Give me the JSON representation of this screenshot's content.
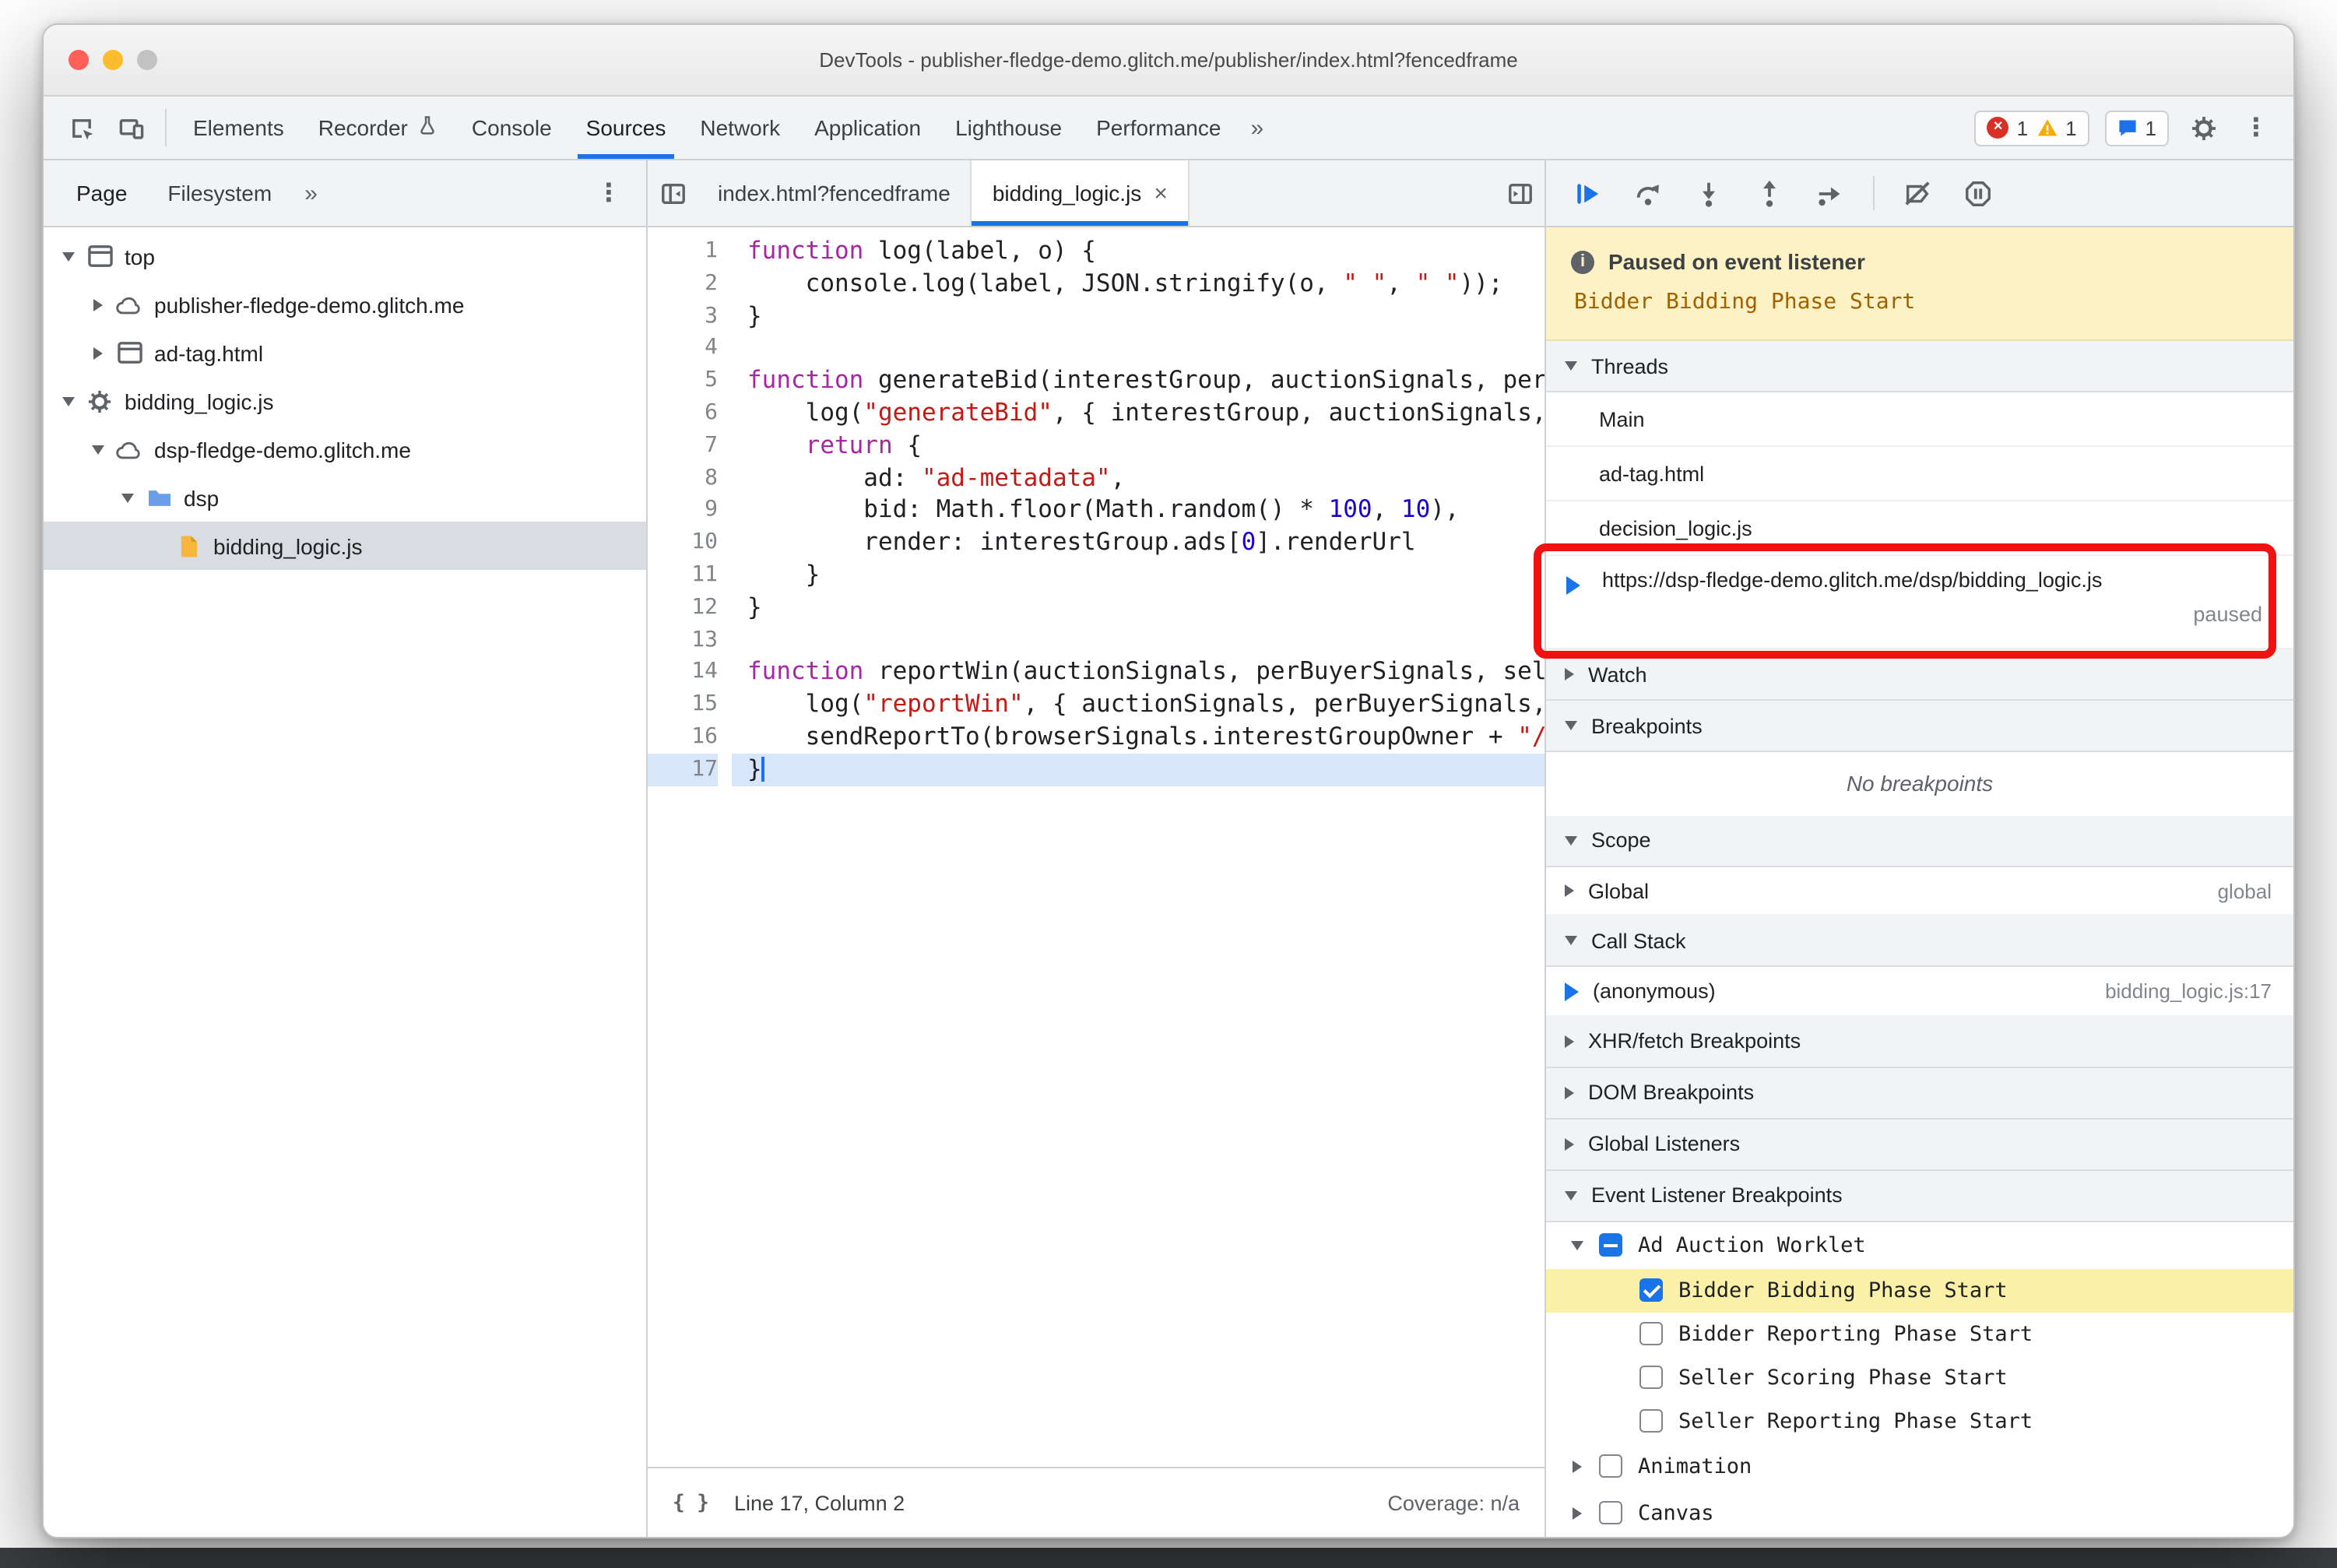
{
  "window": {
    "title": "DevTools - publisher-fledge-demo.glitch.me/publisher/index.html?fencedframe"
  },
  "toolbar": {
    "tabs": [
      {
        "label": "Elements"
      },
      {
        "label": "Recorder",
        "experiment": true
      },
      {
        "label": "Console"
      },
      {
        "label": "Sources",
        "active": true
      },
      {
        "label": "Network"
      },
      {
        "label": "Application"
      },
      {
        "label": "Lighthouse"
      },
      {
        "label": "Performance"
      }
    ],
    "more_tabs_label": "»",
    "error_count": "1",
    "warning_count": "1",
    "message_count": "1"
  },
  "navigator": {
    "tabs": [
      {
        "label": "Page",
        "active": true
      },
      {
        "label": "Filesystem"
      }
    ],
    "more_label": "»",
    "tree": [
      {
        "depth": 0,
        "arrow": "down",
        "icon": "frame",
        "label": "top"
      },
      {
        "depth": 1,
        "arrow": "right",
        "icon": "cloud",
        "label": "publisher-fledge-demo.glitch.me"
      },
      {
        "depth": 1,
        "arrow": "right",
        "icon": "frame",
        "label": "ad-tag.html"
      },
      {
        "depth": 0,
        "arrow": "down",
        "icon": "gear",
        "label": "bidding_logic.js"
      },
      {
        "depth": 1,
        "arrow": "down",
        "icon": "cloud",
        "label": "dsp-fledge-demo.glitch.me"
      },
      {
        "depth": 2,
        "arrow": "down",
        "icon": "folder",
        "label": "dsp"
      },
      {
        "depth": 3,
        "arrow": "none",
        "icon": "file",
        "label": "bidding_logic.js",
        "selected": true
      }
    ]
  },
  "editor": {
    "tabs": [
      {
        "label": "index.html?fencedframe"
      },
      {
        "label": "bidding_logic.js",
        "active": true,
        "close_label": "×"
      }
    ],
    "lines": [
      {
        "n": 1,
        "tokens": [
          {
            "t": "function",
            "c": "k"
          },
          {
            "t": " log(label, o) {"
          }
        ]
      },
      {
        "n": 2,
        "tokens": [
          {
            "t": "    console.log(label, JSON.stringify(o, "
          },
          {
            "t": "\" \"",
            "c": "s"
          },
          {
            "t": ", "
          },
          {
            "t": "\" \"",
            "c": "s"
          },
          {
            "t": "));"
          }
        ]
      },
      {
        "n": 3,
        "tokens": [
          {
            "t": "}"
          }
        ]
      },
      {
        "n": 4,
        "tokens": []
      },
      {
        "n": 5,
        "tokens": [
          {
            "t": "function",
            "c": "k"
          },
          {
            "t": " generateBid(interestGroup, auctionSignals, perBuyerSignals, trustedBiddingSignals, browserSignals) {"
          }
        ]
      },
      {
        "n": 6,
        "tokens": [
          {
            "t": "    log("
          },
          {
            "t": "\"generateBid\"",
            "c": "s"
          },
          {
            "t": ", { interestGroup, auctionSignals, perBuyerSignals, trustedBiddingSignals, browserSignals });"
          }
        ]
      },
      {
        "n": 7,
        "tokens": [
          {
            "t": "    "
          },
          {
            "t": "return",
            "c": "k"
          },
          {
            "t": " {"
          }
        ]
      },
      {
        "n": 8,
        "tokens": [
          {
            "t": "        ad: "
          },
          {
            "t": "\"ad-metadata\"",
            "c": "s"
          },
          {
            "t": ","
          }
        ]
      },
      {
        "n": 9,
        "tokens": [
          {
            "t": "        bid: Math.floor(Math.random() * "
          },
          {
            "t": "100",
            "c": "n"
          },
          {
            "t": ", "
          },
          {
            "t": "10",
            "c": "n"
          },
          {
            "t": "),"
          }
        ]
      },
      {
        "n": 10,
        "tokens": [
          {
            "t": "        render: interestGroup.ads["
          },
          {
            "t": "0",
            "c": "n"
          },
          {
            "t": "].renderUrl"
          }
        ]
      },
      {
        "n": 11,
        "tokens": [
          {
            "t": "    }"
          }
        ]
      },
      {
        "n": 12,
        "tokens": [
          {
            "t": "}"
          }
        ]
      },
      {
        "n": 13,
        "tokens": []
      },
      {
        "n": 14,
        "tokens": [
          {
            "t": "function",
            "c": "k"
          },
          {
            "t": " reportWin(auctionSignals, perBuyerSignals, sellerSignals, browserSignals) {"
          }
        ]
      },
      {
        "n": 15,
        "tokens": [
          {
            "t": "    log("
          },
          {
            "t": "\"reportWin\"",
            "c": "s"
          },
          {
            "t": ", { auctionSignals, perBuyerSignals, sellerSignals, browserSignals });"
          }
        ]
      },
      {
        "n": 16,
        "tokens": [
          {
            "t": "    sendReportTo(browserSignals.interestGroupOwner + "
          },
          {
            "t": "\"/report-win\"",
            "c": "s"
          },
          {
            "t": ");"
          }
        ]
      },
      {
        "n": 17,
        "tokens": [
          {
            "t": "}"
          }
        ],
        "current": true
      }
    ],
    "status": {
      "position": "Line 17, Column 2",
      "coverage": "Coverage: n/a"
    }
  },
  "debugger": {
    "banner": {
      "title": "Paused on event listener",
      "subtitle": "Bidder Bidding Phase Start"
    },
    "threads": {
      "title": "Threads",
      "items": [
        {
          "label": "Main"
        },
        {
          "label": "ad-tag.html"
        },
        {
          "label": "decision_logic.js"
        },
        {
          "label": "https://dsp-fledge-demo.glitch.me/dsp/bidding_logic.js",
          "status": "paused",
          "active": true
        }
      ]
    },
    "watch": {
      "title": "Watch"
    },
    "breakpoints": {
      "title": "Breakpoints",
      "empty_message": "No breakpoints"
    },
    "scope": {
      "title": "Scope",
      "rows": [
        {
          "label": "Global",
          "value": "global"
        }
      ]
    },
    "call_stack": {
      "title": "Call Stack",
      "rows": [
        {
          "label": "(anonymous)",
          "location": "bidding_logic.js:17",
          "active": true
        }
      ]
    },
    "collapsed_sections": [
      {
        "title": "XHR/fetch Breakpoints"
      },
      {
        "title": "DOM Breakpoints"
      },
      {
        "title": "Global Listeners"
      }
    ],
    "event_listener_breakpoints": {
      "title": "Event Listener Breakpoints",
      "groups": [
        {
          "label": "Ad Auction Worklet",
          "expanded": true,
          "checkbox": "indeterminate",
          "items": [
            {
              "label": "Bidder Bidding Phase Start",
              "checkbox": "checked",
              "highlighted": true
            },
            {
              "label": "Bidder Reporting Phase Start",
              "checkbox": "unchecked"
            },
            {
              "label": "Seller Scoring Phase Start",
              "checkbox": "unchecked"
            },
            {
              "label": "Seller Reporting Phase Start",
              "checkbox": "unchecked"
            }
          ]
        },
        {
          "label": "Animation",
          "expanded": false,
          "checkbox": "unchecked",
          "items": []
        },
        {
          "label": "Canvas",
          "expanded": false,
          "checkbox": "unchecked",
          "items": []
        }
      ]
    }
  },
  "colors": {
    "accent": "#1a73e8",
    "paused_banner_bg": "#fcf2c5",
    "annotation_red": "#f01111",
    "selected_breakpoint_row": "#fbf0a7"
  }
}
